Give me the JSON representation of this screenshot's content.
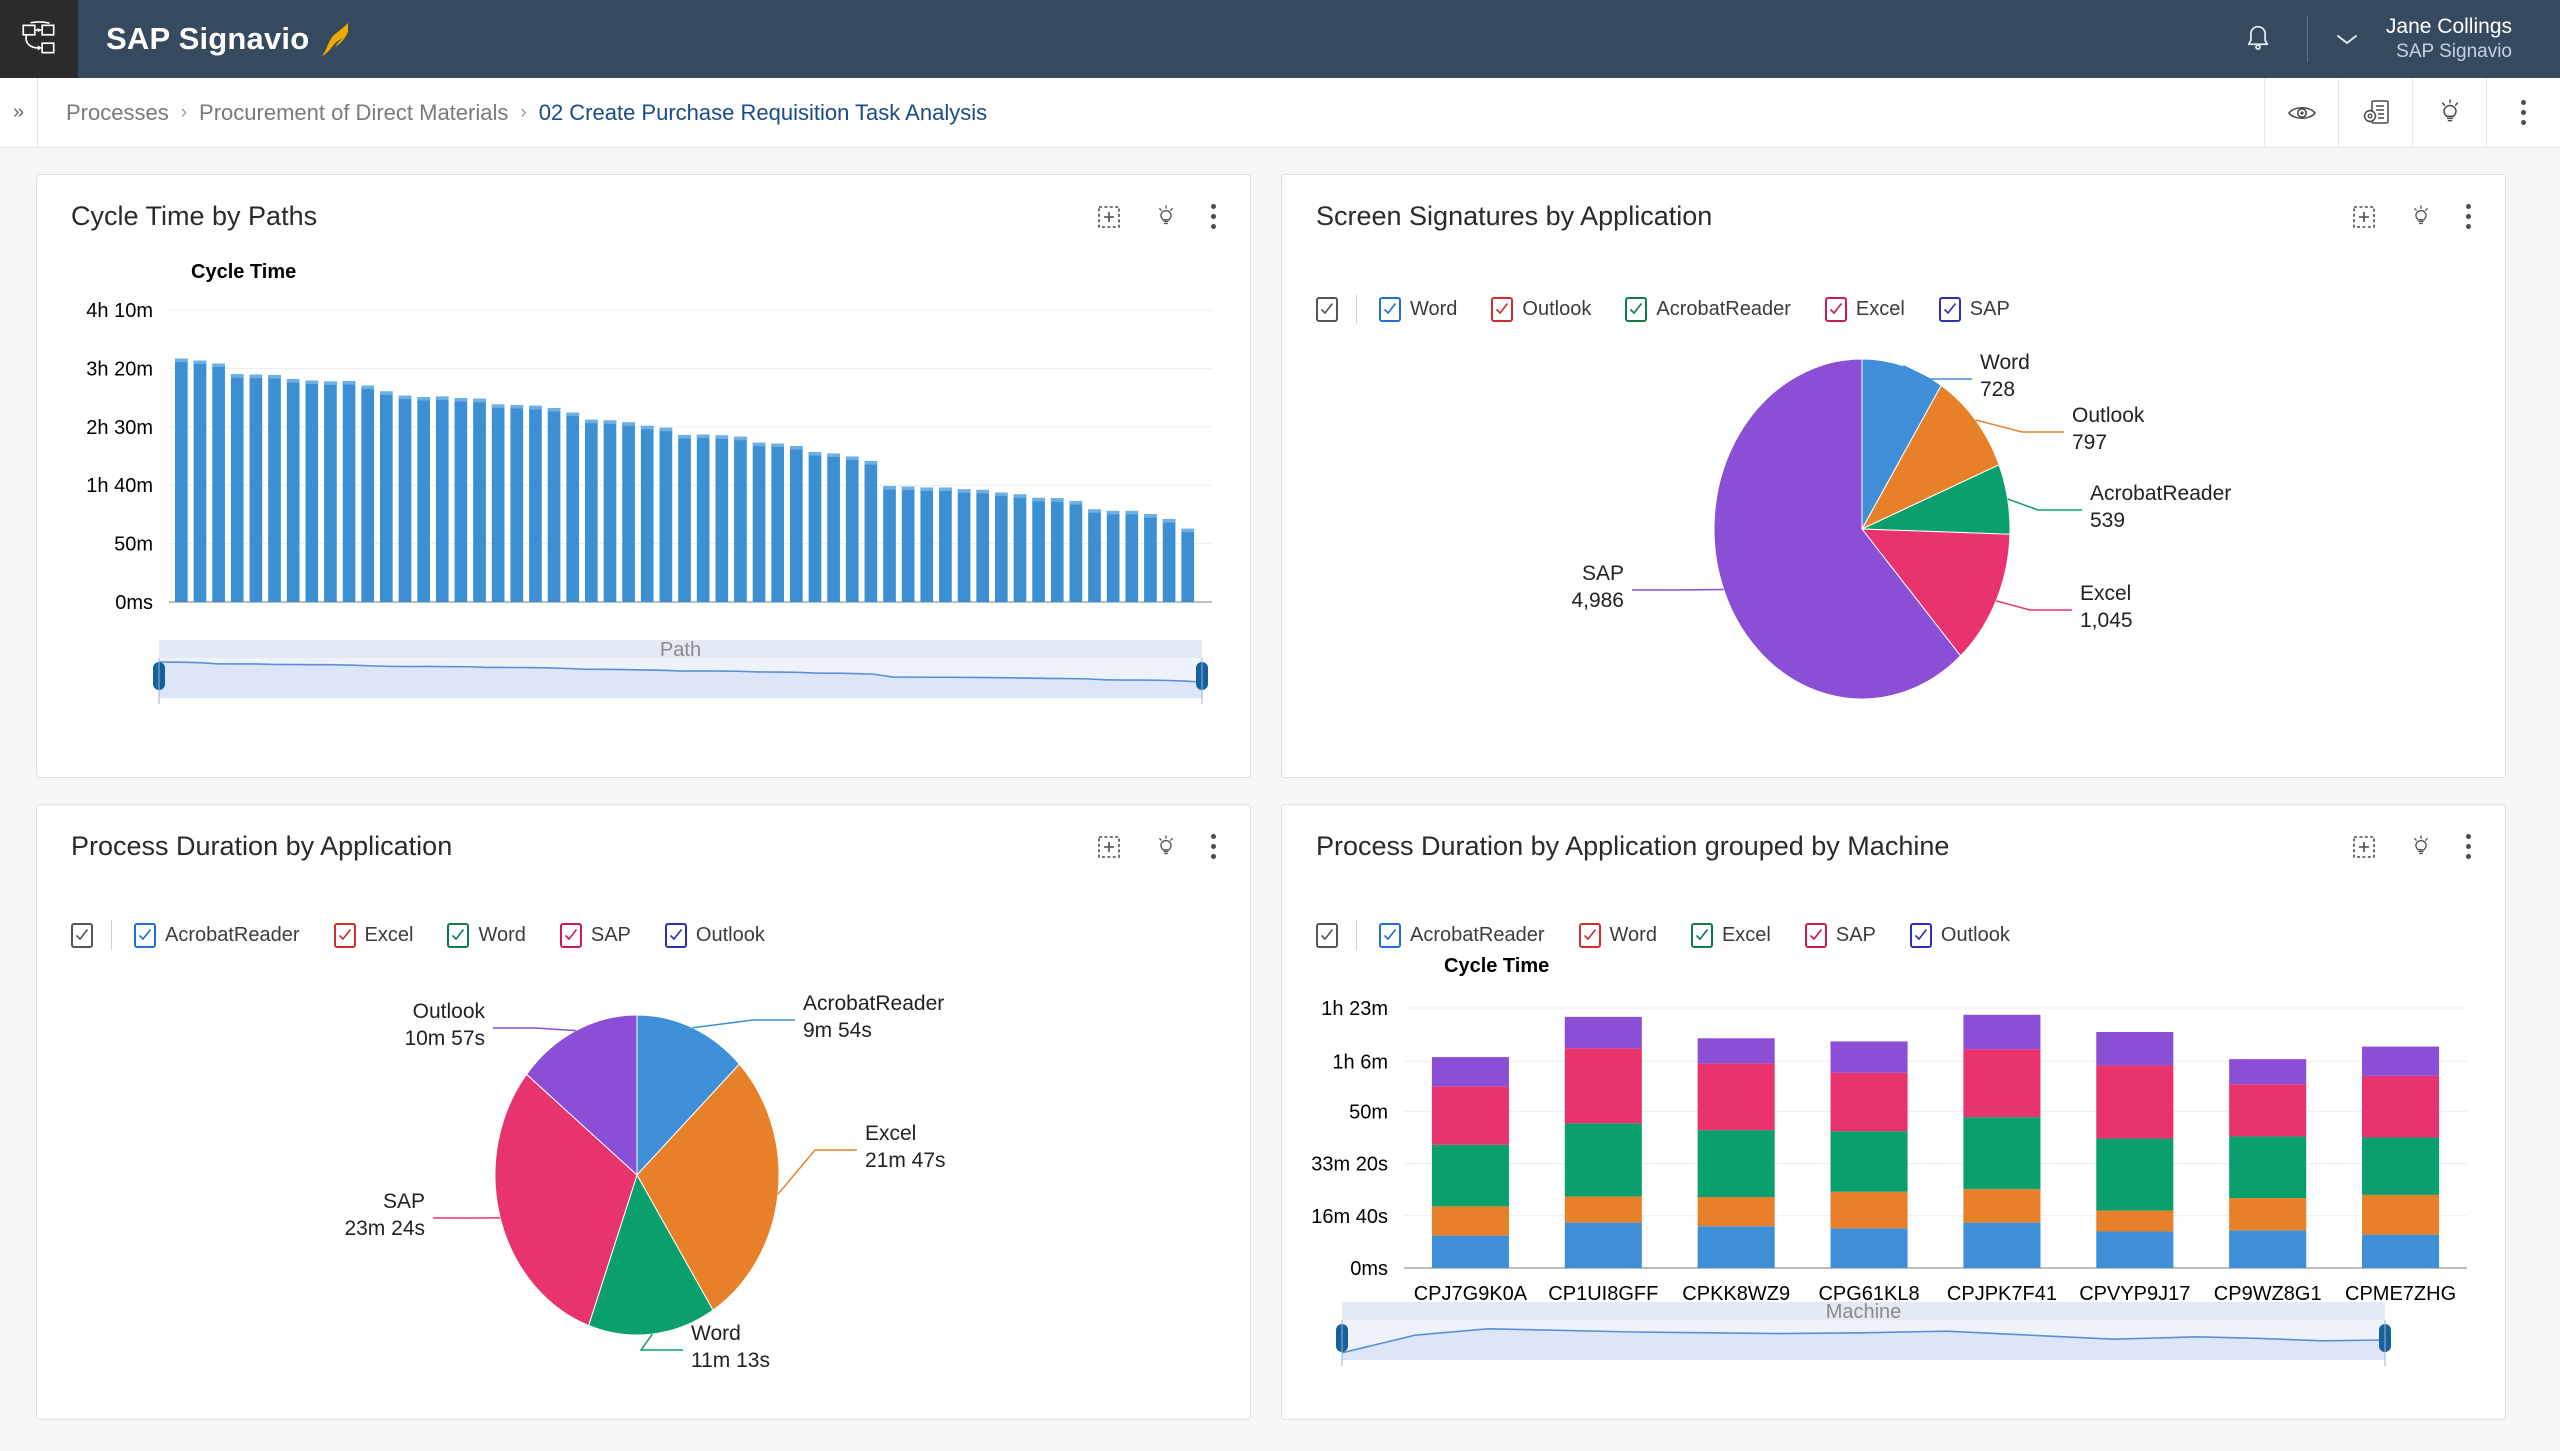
{
  "topbar": {
    "app_icon": "process-app-icon",
    "brand": "SAP Signavio",
    "brand_mark": "signavio-gazelle-logo",
    "bell_icon": "notifications-bell-icon",
    "chevron_icon": "chevron-down-icon",
    "user_name": "Jane Collings",
    "user_org": "SAP Signavio",
    "bg_color": "#354a5f"
  },
  "breadcrumb": {
    "expand_icon": "expand-sidebar-icon",
    "items": [
      {
        "label": "Processes",
        "active": false
      },
      {
        "label": "Procurement of Direct Materials",
        "active": false
      },
      {
        "label": "02 Create Purchase Requisition Task Analysis",
        "active": true
      }
    ],
    "separator": "›",
    "actions": [
      {
        "name": "view-eye-icon"
      },
      {
        "name": "settings-report-icon"
      },
      {
        "name": "insights-bulb-icon"
      },
      {
        "name": "more-options-icon"
      }
    ],
    "accent_color": "#1b4a8a"
  },
  "card_tools": [
    {
      "name": "add-widget-icon"
    },
    {
      "name": "insights-bulb-icon"
    },
    {
      "name": "more-options-icon"
    }
  ],
  "cards": [
    {
      "id": "cycle-time-by-paths",
      "title": "Cycle Time by Paths"
    },
    {
      "id": "screen-signatures-by-application",
      "title": "Screen Signatures by Application"
    },
    {
      "id": "process-duration-by-application",
      "title": "Process Duration by Application"
    },
    {
      "id": "process-duration-by-application-grouped-by-machine",
      "title": "Process Duration by Application grouped by Machine"
    }
  ],
  "palette": {
    "bar_blue": "#3d8fd4",
    "bar_blue_top": "#6cb0e4",
    "slice_blue": "#3f8fd8",
    "slice_orange": "#e8802a",
    "slice_green": "#0aa06e",
    "slice_pink": "#e8336d",
    "slice_purple": "#8b4fd6",
    "brush_fill": "#e8eefb",
    "brush_handle": "#14619e"
  },
  "legend_checkbox_colors": {
    "master": "#555555",
    "blue": "#1e6fd9",
    "red": "#cf2e2e",
    "green": "#0f7a4a",
    "pink": "#c9185c",
    "navy": "#2e2eb8"
  },
  "chart_data": [
    {
      "id": "cycle-time-by-paths",
      "type": "bar",
      "title": "Cycle Time by Paths",
      "ylabel": "Cycle Time",
      "xlabel": "Path",
      "grid": true,
      "legend": "none",
      "ytick_labels": [
        "4h 10m",
        "3h 20m",
        "2h 30m",
        "1h 40m",
        "50m",
        "0ms"
      ],
      "ytick_values": [
        15000,
        12000,
        9000,
        6000,
        3000,
        0
      ],
      "ylim": [
        0,
        15000
      ],
      "xtick_labels": [],
      "values": [
        12500,
        12400,
        12250,
        11700,
        11680,
        11660,
        11450,
        11370,
        11330,
        11350,
        11120,
        10820,
        10600,
        10530,
        10560,
        10480,
        10440,
        10150,
        10120,
        10080,
        9960,
        9730,
        9360,
        9330,
        9230,
        9050,
        8950,
        8580,
        8600,
        8560,
        8490,
        8180,
        8140,
        8010,
        7700,
        7630,
        7470,
        7240,
        5950,
        5930,
        5880,
        5880,
        5790,
        5760,
        5620,
        5530,
        5350,
        5330,
        5180,
        4760,
        4680,
        4680,
        4520,
        4260,
        3760
      ],
      "brush": {
        "label": "Path",
        "left_handle_pct": 0,
        "right_handle_pct": 100
      }
    },
    {
      "id": "screen-signatures-by-application",
      "type": "pie",
      "title": "Screen Signatures by Application",
      "legend": "top",
      "legend_items": [
        {
          "label": "Word",
          "color_key": "blue",
          "checked": true
        },
        {
          "label": "Outlook",
          "color_key": "red",
          "checked": true
        },
        {
          "label": "AcrobatReader",
          "color_key": "green",
          "checked": true
        },
        {
          "label": "Excel",
          "color_key": "pink",
          "checked": true
        },
        {
          "label": "SAP",
          "color_key": "navy",
          "checked": true
        }
      ],
      "labels": [
        "Word",
        "Outlook",
        "AcrobatReader",
        "Excel",
        "SAP"
      ],
      "values": [
        728,
        797,
        539,
        1045,
        4986
      ],
      "value_labels": [
        "728",
        "797",
        "539",
        "1,045",
        "4,986"
      ],
      "colors": [
        "#3f8fd8",
        "#e8802a",
        "#0aa06e",
        "#e8336d",
        "#8b4fd6"
      ],
      "total": 8095
    },
    {
      "id": "process-duration-by-application",
      "type": "pie",
      "title": "Process Duration by Application",
      "legend": "top",
      "legend_items": [
        {
          "label": "AcrobatReader",
          "color_key": "blue",
          "checked": true
        },
        {
          "label": "Excel",
          "color_key": "red",
          "checked": true
        },
        {
          "label": "Word",
          "color_key": "green",
          "checked": true
        },
        {
          "label": "SAP",
          "color_key": "pink",
          "checked": true
        },
        {
          "label": "Outlook",
          "color_key": "navy",
          "checked": true
        }
      ],
      "labels": [
        "AcrobatReader",
        "Excel",
        "Word",
        "SAP",
        "Outlook"
      ],
      "value_labels": [
        "9m 54s",
        "21m 47s",
        "11m 13s",
        "23m 24s",
        "10m 57s"
      ],
      "values": [
        594,
        1307,
        673,
        1404,
        657
      ],
      "unit": "seconds",
      "colors": [
        "#3f8fd8",
        "#e8802a",
        "#0aa06e",
        "#e8336d",
        "#8b4fd6"
      ],
      "total": 4635
    },
    {
      "id": "process-duration-by-application-grouped-by-machine",
      "type": "bar",
      "stacked": true,
      "title": "Process Duration by Application grouped by Machine",
      "ylabel": "Cycle Time",
      "xlabel": "Machine",
      "grid": true,
      "legend": "top",
      "legend_items": [
        {
          "label": "AcrobatReader",
          "color_key": "blue",
          "checked": true
        },
        {
          "label": "Word",
          "color_key": "red",
          "checked": true
        },
        {
          "label": "Excel",
          "color_key": "green",
          "checked": true
        },
        {
          "label": "SAP",
          "color_key": "pink",
          "checked": true
        },
        {
          "label": "Outlook",
          "color_key": "navy",
          "checked": true
        }
      ],
      "ytick_labels": [
        "1h 23m",
        "1h 6m",
        "50m",
        "33m 20s",
        "16m 40s",
        "0ms"
      ],
      "ytick_values": [
        4980,
        3960,
        3000,
        2000,
        1000,
        0
      ],
      "ylim": [
        0,
        4980
      ],
      "categories": [
        "CPJ7G9K0A",
        "CP1UI8GFF",
        "CPKK8WZ9",
        "CPG61KL8",
        "CPJPK7F41",
        "CPVYP9J17",
        "CP9WZ8G1",
        "CPME7ZHG"
      ],
      "series": [
        {
          "name": "AcrobatReader",
          "color": "#3f8fd8",
          "values": [
            620,
            870,
            800,
            760,
            870,
            700,
            720,
            640
          ]
        },
        {
          "name": "Excel",
          "color": "#e8802a",
          "values": [
            560,
            500,
            560,
            700,
            640,
            400,
            620,
            760
          ]
        },
        {
          "name": "Word",
          "color": "#0aa06e",
          "values": [
            1180,
            1400,
            1280,
            1160,
            1380,
            1380,
            1180,
            1100
          ]
        },
        {
          "name": "SAP",
          "color": "#e8336d",
          "values": [
            1120,
            1440,
            1280,
            1120,
            1300,
            1400,
            1000,
            1180
          ]
        },
        {
          "name": "Outlook",
          "color": "#8b4fd6",
          "values": [
            560,
            600,
            480,
            600,
            660,
            640,
            480,
            560
          ]
        }
      ],
      "brush": {
        "label": "Machine",
        "left_handle_pct": 0,
        "right_handle_pct": 100
      }
    }
  ]
}
